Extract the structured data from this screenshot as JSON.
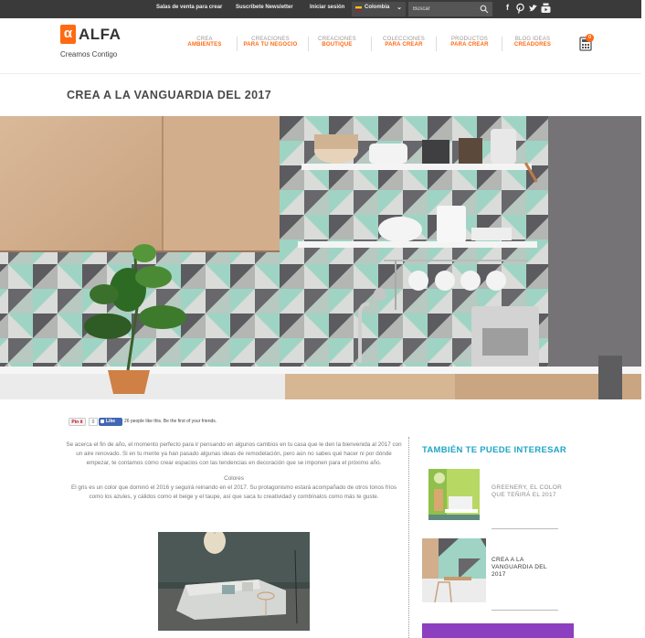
{
  "topbar": {
    "links": [
      "Salas de venta para crear",
      "Suscríbete Newsletter",
      "Iniciar sesión"
    ],
    "country": "Colombia",
    "search_placeholder": "Buscar",
    "social": [
      "facebook-icon",
      "pinterest-icon",
      "twitter-icon",
      "youtube-icon"
    ]
  },
  "brand": {
    "name": "ALFA",
    "tagline": "Creamos Contigo",
    "accent": "#ff6a13"
  },
  "nav": [
    {
      "top": "CREA",
      "bottom": "AMBIENTES"
    },
    {
      "top": "CREACIONES",
      "bottom": "PARA TU NEGOCIO"
    },
    {
      "top": "CREACIONES",
      "bottom": "BOUTIQUE"
    },
    {
      "top": "COLECCIONES",
      "bottom": "PARA CREAR"
    },
    {
      "top": "PRODUCTOS",
      "bottom": "PARA CREAR"
    },
    {
      "top": "BLOG IDEAS",
      "bottom": "CREADORES"
    }
  ],
  "cart": {
    "count": "0"
  },
  "page": {
    "title": "CREA A LA VANGUARDIA DEL 2017"
  },
  "share": {
    "pin_label": "Pin it",
    "pin_count": "0",
    "fb_label": "Like",
    "fb_text": "26 people like this. Be the first of your friends."
  },
  "article": {
    "intro": "Se acerca el fin de año, el momento perfecto para ir pensando en algunos cambios en tu casa que le den la bienvenida al 2017 con un aire renovado. Si en tu mente ya han pasado algunas ideas de remodelación, pero aún no sabes qué hacer ni por dónde empezar, te contamos cómo crear espacios con las tendencias en decoración que se imponen para el próximo año.",
    "subhead": "Colores",
    "body": "El gris es un color que dominó el 2016 y seguirá reinando en el 2017. Su protagonismo estará acompañado de otros tonos fríos como los azules, y cálidos como el beige y el taupe, así que saca tu creatividad y combínalos como más te guste."
  },
  "sidebar": {
    "title": "TAMBIÉN TE PUEDE INTERESAR",
    "items": [
      {
        "title": "GREENERY, EL COLOR QUE TEÑIRÁ EL 2017",
        "color": "#8a8a8a"
      },
      {
        "title": "CREA A LA VANGUARDIA DEL 2017",
        "color": "#333333"
      }
    ]
  },
  "colors": {
    "topbar": "#3a3a3a",
    "side_title": "#1ea5c7",
    "purple": "#8c3fbf"
  }
}
